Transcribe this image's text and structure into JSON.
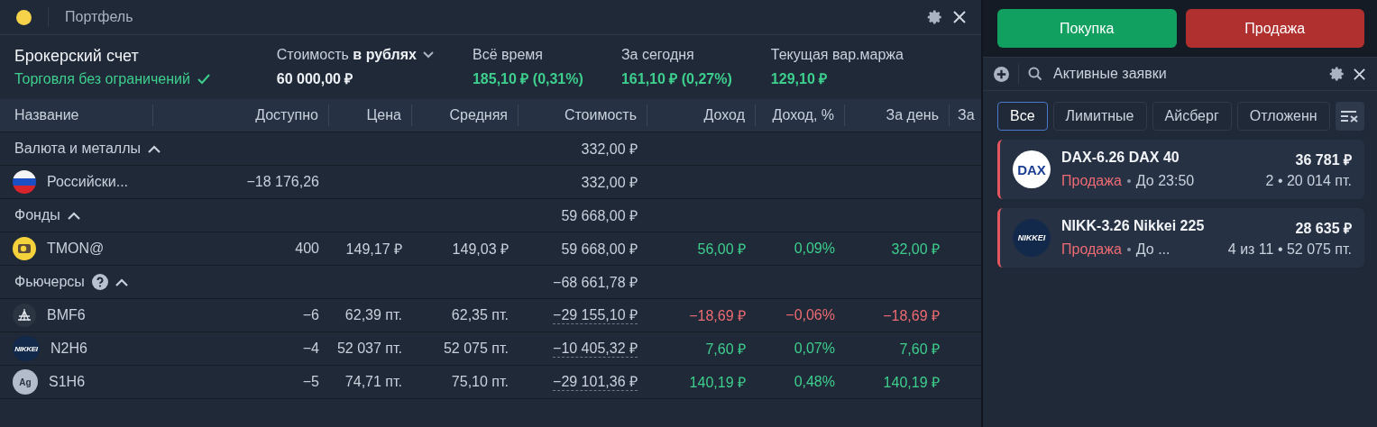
{
  "portfolio": {
    "title": "Портфель",
    "account": {
      "name": "Брокерский счет",
      "status": "Торговля без ограничений",
      "status_ok": true
    },
    "summary": [
      {
        "kind": "value",
        "label": "Стоимость",
        "label_strong": "в рублях",
        "value": "60 000,00 ₽"
      },
      {
        "kind": "gain",
        "label": "Всё время",
        "value": "185,10 ₽ (0,31%)"
      },
      {
        "kind": "gain",
        "label": "За сегодня",
        "value": "161,10 ₽ (0,27%)"
      },
      {
        "kind": "gain",
        "label": "Текущая вар.маржа",
        "value": "129,10 ₽"
      }
    ],
    "columns": [
      "Название",
      "Доступно",
      "Цена",
      "Средняя",
      "Стоимость",
      "Доход",
      "Доход, %",
      "За день",
      "За"
    ],
    "groups": [
      {
        "label": "Валюта и металлы",
        "expanded": true,
        "total": "332,00 ₽",
        "rows": [
          {
            "name": "Российски...",
            "available": "−18 176,26",
            "value": "332,00 ₽"
          }
        ]
      },
      {
        "label": "Фонды",
        "expanded": true,
        "total": "59 668,00 ₽",
        "rows": [
          {
            "name": "TMON@",
            "available": "400",
            "price": "149,17 ₽",
            "avg": "149,03 ₽",
            "value": "59 668,00 ₽",
            "income": "56,00 ₽",
            "income_pct": "0,09%",
            "day": "32,00 ₽",
            "negative": false
          }
        ]
      },
      {
        "label": "Фьючерсы",
        "expanded": true,
        "help": true,
        "total": "−68 661,78 ₽",
        "rows": [
          {
            "name": "BMF6",
            "available": "−6",
            "price": "62,39 пт.",
            "avg": "62,35 пт.",
            "value": "−29 155,10 ₽",
            "income": "−18,69 ₽",
            "income_pct": "−0,06%",
            "day": "−18,69 ₽",
            "negative": true,
            "dashed": true
          },
          {
            "logo_text": "NIKKEI",
            "name": "N2H6",
            "available": "−4",
            "price": "52 037 пт.",
            "avg": "52 075 пт.",
            "value": "−10 405,32 ₽",
            "income": "7,60 ₽",
            "income_pct": "0,07%",
            "day": "7,60 ₽",
            "negative": false,
            "dashed": true
          },
          {
            "logo_text": "Ag",
            "name": "S1H6",
            "available": "−5",
            "price": "74,71 пт.",
            "avg": "75,10 пт.",
            "value": "−29 101,36 ₽",
            "income": "140,19 ₽",
            "income_pct": "0,48%",
            "day": "140,19 ₽",
            "negative": false,
            "dashed": true
          }
        ]
      }
    ]
  },
  "trade_buttons": [
    {
      "kind": "buy",
      "label": "Покупка"
    },
    {
      "kind": "sell",
      "label": "Продажа"
    }
  ],
  "orders": {
    "title": "Активные заявки",
    "tabs": [
      {
        "label": "Все",
        "selected": true
      },
      {
        "label": "Лимитные",
        "selected": false
      },
      {
        "label": "Айсберг",
        "selected": false
      },
      {
        "label": "Отложенн",
        "selected": false
      }
    ],
    "items": [
      {
        "logo_text": "DAX",
        "name": "DAX-6.26 DAX 40",
        "amount": "36 781 ₽",
        "kind": "sell",
        "side_label": "Продажа",
        "expiry": "До 23:50",
        "details": "2 • 20 014 пт."
      },
      {
        "logo_text": "NIKKEI",
        "name": "NIKK-3.26 Nikkei 225",
        "amount": "28 635 ₽",
        "kind": "sell",
        "side_label": "Продажа",
        "expiry": "До ...",
        "details": "4 из 11 • 52 075 пт."
      }
    ]
  }
}
